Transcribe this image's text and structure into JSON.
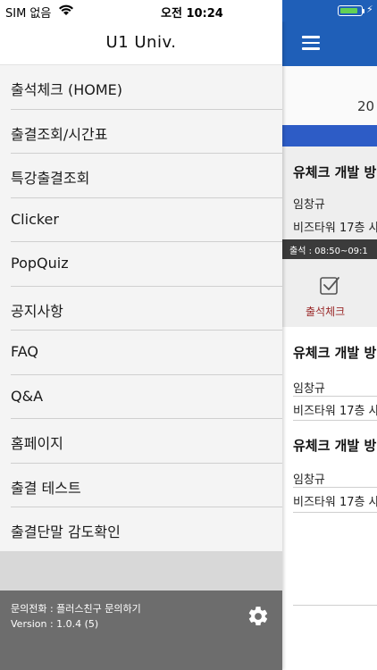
{
  "status_bar": {
    "carrier": "SIM 없음",
    "time": "오전 10:24",
    "battery_level": 0.9,
    "battery_color": "#63d154"
  },
  "drawer": {
    "title": "U1 Univ.",
    "items": [
      {
        "label": "출석체크 (HOME)"
      },
      {
        "label": "출결조회/시간표"
      },
      {
        "label": "특강출결조회"
      },
      {
        "label": "Clicker"
      },
      {
        "label": "PopQuiz"
      },
      {
        "label": "공지사항"
      },
      {
        "label": "FAQ"
      },
      {
        "label": "Q&A"
      },
      {
        "label": "홈페이지"
      },
      {
        "label": "출결 테스트"
      },
      {
        "label": "출결단말 감도확인"
      }
    ],
    "footer": {
      "contact": "문의전화 :  플러스친구 문의하기",
      "version": "Version :  1.0.4 (5)",
      "settings_icon": "gear-icon"
    }
  },
  "background_app": {
    "header_color": "#1f5fb8",
    "date_partial": "20",
    "courses": [
      {
        "title": "유체크 개발 방",
        "professor": "임창규",
        "room": "비즈타워 17층 사",
        "time": "출석 :    08:50~09:1"
      },
      {
        "title": "유체크 개발 방",
        "professor": "임창규",
        "room": "비즈타워 17층 사"
      },
      {
        "title": "유체크 개발 방",
        "professor": "임창규",
        "room": "비즈타워 17층 사"
      }
    ],
    "check_button_label": "출석체크"
  }
}
